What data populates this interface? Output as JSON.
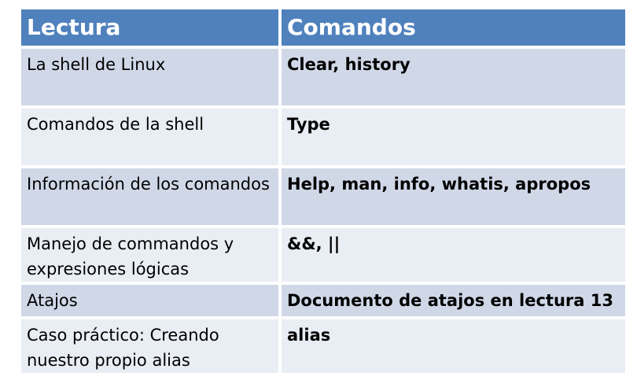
{
  "header": {
    "col1": "Lectura",
    "col2": "Comandos"
  },
  "rows": [
    {
      "lectura": "La shell de Linux",
      "comandos": "Clear, history"
    },
    {
      "lectura": "Comandos de la shell",
      "comandos": "Type"
    },
    {
      "lectura": "Información de los comandos",
      "comandos": "Help, man, info, whatis, apropos"
    },
    {
      "lectura": "Manejo de commandos y expresiones lógicas",
      "comandos": "&&, ||"
    },
    {
      "lectura": "Atajos",
      "comandos": "Documento de atajos en lectura 13"
    },
    {
      "lectura": "Caso práctico: Creando nuestro propio alias",
      "comandos": "alias"
    }
  ],
  "colors": {
    "header_bg": "#4f81bd",
    "row_dark": "#d0d8e8",
    "row_light": "#e9edf4"
  }
}
